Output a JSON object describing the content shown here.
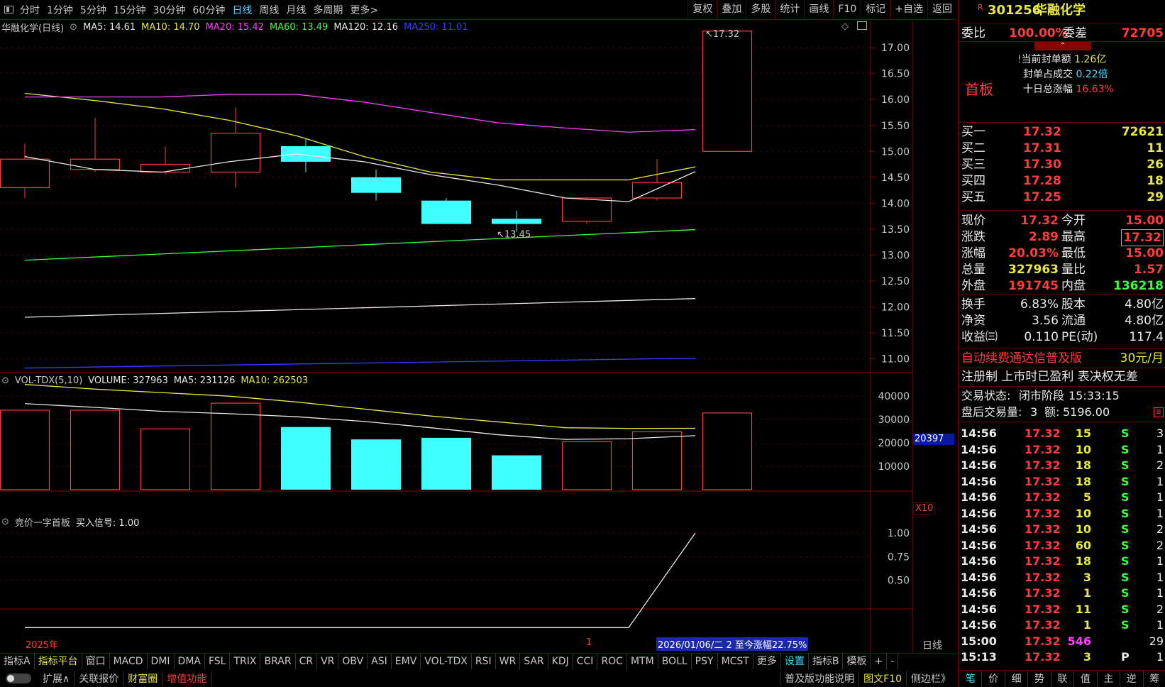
{
  "toolbar": {
    "periods": [
      "分时",
      "1分钟",
      "5分钟",
      "15分钟",
      "30分钟",
      "60分钟",
      "日线",
      "周线",
      "月线",
      "多周期",
      "更多>"
    ],
    "active": "日线",
    "tools": [
      "复权",
      "叠加",
      "多股",
      "统计",
      "画线",
      "F10",
      "标记",
      "+自选",
      "返回"
    ]
  },
  "chart": {
    "title": "华融化学(日线)",
    "ma": [
      {
        "label": "MA5: 14.61",
        "color": "#e8e8e8"
      },
      {
        "label": "MA10: 14.70",
        "color": "#e8e840"
      },
      {
        "label": "MA20: 15.42",
        "color": "#ff40ff"
      },
      {
        "label": "MA60: 13.49",
        "color": "#3cff3c"
      },
      {
        "label": "MA120: 12.16",
        "color": "#e8e8e8"
      },
      {
        "label": "MA250: 11.01",
        "color": "#3040ff"
      }
    ],
    "yticks": [
      "17.00",
      "16.50",
      "16.00",
      "15.50",
      "15.00",
      "14.50",
      "14.00",
      "13.50",
      "13.00",
      "12.50",
      "12.00",
      "11.50",
      "11.00"
    ],
    "high_label": "17.32",
    "low_label": "13.45"
  },
  "chart_data": [
    {
      "type": "candlestick",
      "title": "华融化学(日线)",
      "candles": [
        {
          "o": 14.3,
          "c": 14.85,
          "h": 15.15,
          "l": 14.1
        },
        {
          "o": 14.65,
          "c": 14.85,
          "h": 15.65,
          "l": 14.6
        },
        {
          "o": 14.6,
          "c": 14.75,
          "h": 15.1,
          "l": 14.55
        },
        {
          "o": 14.6,
          "c": 15.35,
          "h": 15.85,
          "l": 14.3
        },
        {
          "o": 15.1,
          "c": 14.8,
          "h": 15.25,
          "l": 14.6
        },
        {
          "o": 14.5,
          "c": 14.2,
          "h": 14.65,
          "l": 14.05
        },
        {
          "o": 14.05,
          "c": 13.6,
          "h": 14.1,
          "l": 13.6
        },
        {
          "o": 13.7,
          "c": 13.6,
          "h": 13.85,
          "l": 13.45
        },
        {
          "o": 13.65,
          "c": 14.1,
          "h": 14.12,
          "l": 13.6
        },
        {
          "o": 14.1,
          "c": 14.4,
          "h": 14.85,
          "l": 14.05
        },
        {
          "o": 15.0,
          "c": 17.32,
          "h": 17.32,
          "l": 15.0
        }
      ],
      "ylim": [
        10.8,
        17.4
      ]
    },
    {
      "type": "bar",
      "title": "VOL-TDX(5,10)",
      "values": [
        34000,
        34000,
        26000,
        37000,
        26800,
        21500,
        22200,
        14700,
        20500,
        24800,
        32796
      ],
      "yticks": [
        "40000",
        "30000",
        "20000",
        "10000"
      ]
    },
    {
      "type": "line",
      "title": "竞价一字首板",
      "values": [
        0,
        0,
        0,
        0,
        0,
        0,
        0,
        0,
        0,
        0,
        1
      ],
      "yticks": [
        "1.00",
        "0.75",
        "0.50"
      ]
    }
  ],
  "volume": {
    "legend": [
      "VOL-TDX(5,10)",
      "VOLUME: 327963",
      "MA5: 231126",
      "MA10: 262503"
    ],
    "marker": "20397",
    "unit": "X10"
  },
  "indicator": {
    "legend": [
      "竞价一字首板",
      "买入信号: 1.00"
    ]
  },
  "xaxis": {
    "year": "2025年",
    "month": "1",
    "range_label": "2026/01/06/二 2 至今涨幅22.75%",
    "period": "日线"
  },
  "bottom_tabs": [
    "指标A",
    "指标平台",
    "窗口",
    "MACD",
    "DMI",
    "DMA",
    "FSL",
    "TRIX",
    "BRAR",
    "CR",
    "VR",
    "OBV",
    "ASI",
    "EMV",
    "VOL-TDX",
    "RSI",
    "WR",
    "SAR",
    "KDJ",
    "CCI",
    "ROC",
    "MTM",
    "BOLL",
    "PSY",
    "MCST",
    "更多",
    "设置",
    "指标B",
    "模板",
    "+",
    "-"
  ],
  "bottom2": [
    "扩展∧",
    "关联报价",
    "财富圈",
    "增值功能"
  ],
  "bottom2_right": [
    "普及版功能说明",
    "图文F10",
    "侧边栏》"
  ],
  "side_tabs": [
    "笔",
    "价",
    "细",
    "势",
    "联",
    "值",
    "主",
    "逆",
    "筹"
  ],
  "stock": {
    "code": "301256",
    "name": "华融化学",
    "weibi_label": "委比",
    "weibi": "100.00%",
    "weicha_label": "委差",
    "weicha": "72705",
    "board": "首板",
    "seal_amount_label": "当前封单额",
    "seal_amount": "1.26亿",
    "seal_ratio_label": "封单占成交",
    "seal_ratio": "0.22倍",
    "ten_day_label": "十日总涨幅",
    "ten_day": "16.63%"
  },
  "buys": [
    {
      "label": "买一",
      "price": "17.32",
      "vol": "72621"
    },
    {
      "label": "买二",
      "price": "17.31",
      "vol": "11"
    },
    {
      "label": "买三",
      "price": "17.30",
      "vol": "26"
    },
    {
      "label": "买四",
      "price": "17.28",
      "vol": "18"
    },
    {
      "label": "买五",
      "price": "17.25",
      "vol": "29"
    }
  ],
  "quote": [
    {
      "l1": "现价",
      "v1": "17.32",
      "l2": "今开",
      "v2": "15.00"
    },
    {
      "l1": "涨跌",
      "v1": "2.89",
      "l2": "最高",
      "v2": "17.32"
    },
    {
      "l1": "涨幅",
      "v1": "20.03%",
      "l2": "最低",
      "v2": "15.00"
    },
    {
      "l1": "总量",
      "v1": "327963",
      "l2": "量比",
      "v2": "1.57"
    },
    {
      "l1": "外盘",
      "v1": "191745",
      "l2": "内盘",
      "v2": "136218"
    }
  ],
  "finance": [
    {
      "l1": "换手",
      "v1": "6.83%",
      "l2": "股本",
      "v2": "4.80亿"
    },
    {
      "l1": "净资",
      "v1": "3.56",
      "l2": "流通",
      "v2": "4.80亿"
    },
    {
      "l1": "收益㈢",
      "v1": "0.110",
      "l2": "PE(动)",
      "v2": "117.4"
    }
  ],
  "ad": {
    "text": "自动续费通达信普及版",
    "price": "30元/月"
  },
  "notice": "注册制 上市时已盈利 表决权无差",
  "trade": {
    "status_label": "交易状态:",
    "status": "闭市阶段",
    "time": "15:33:15",
    "after_label": "盘后交易量:",
    "after_vol": "3",
    "amount_label": "额:",
    "amount": "5196.00"
  },
  "ticks": [
    {
      "t": "14:56",
      "p": "17.32",
      "v": "15",
      "s": "S",
      "n": "3"
    },
    {
      "t": "14:56",
      "p": "17.32",
      "v": "10",
      "s": "S",
      "n": "1"
    },
    {
      "t": "14:56",
      "p": "17.32",
      "v": "18",
      "s": "S",
      "n": "2"
    },
    {
      "t": "14:56",
      "p": "17.32",
      "v": "18",
      "s": "S",
      "n": "1"
    },
    {
      "t": "14:56",
      "p": "17.32",
      "v": "5",
      "s": "S",
      "n": "1"
    },
    {
      "t": "14:56",
      "p": "17.32",
      "v": "10",
      "s": "S",
      "n": "1"
    },
    {
      "t": "14:56",
      "p": "17.32",
      "v": "10",
      "s": "S",
      "n": "2"
    },
    {
      "t": "14:56",
      "p": "17.32",
      "v": "60",
      "s": "S",
      "n": "2"
    },
    {
      "t": "14:56",
      "p": "17.32",
      "v": "18",
      "s": "S",
      "n": "1"
    },
    {
      "t": "14:56",
      "p": "17.32",
      "v": "3",
      "s": "S",
      "n": "1"
    },
    {
      "t": "14:56",
      "p": "17.32",
      "v": "1",
      "s": "S",
      "n": "1"
    },
    {
      "t": "14:56",
      "p": "17.32",
      "v": "11",
      "s": "S",
      "n": "2"
    },
    {
      "t": "14:56",
      "p": "17.32",
      "v": "1",
      "s": "S",
      "n": "1"
    },
    {
      "t": "15:00",
      "p": "17.32",
      "v": "546",
      "s": "",
      "n": "29"
    },
    {
      "t": "15:13",
      "p": "17.32",
      "v": "3",
      "s": "P",
      "n": "1"
    }
  ]
}
